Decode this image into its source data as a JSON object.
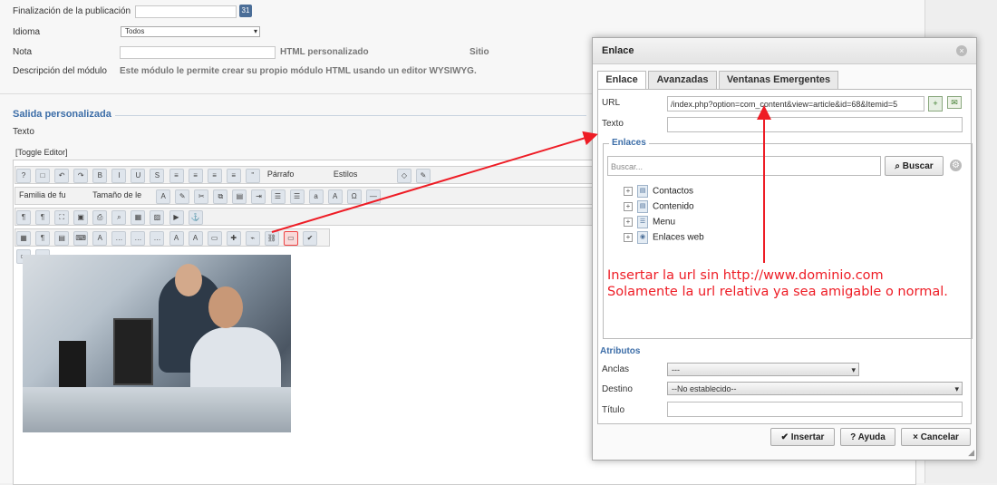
{
  "form": {
    "finalizacion_label": "Finalización de la publicación",
    "idioma_label": "Idioma",
    "idioma_value": "Todos",
    "nota_label": "Nota",
    "html_personalizado": "HTML personalizado",
    "sitio": "Sitio",
    "descripcion_label": "Descripción del módulo",
    "descripcion_value": "Este módulo le permite crear su propio módulo HTML usando un editor WYSIWYG.",
    "calendar_icon_text": "31"
  },
  "editor": {
    "section_title": "Salida personalizada",
    "texto_label": "Texto",
    "toggle_editor": "[Toggle Editor]",
    "paragraph_select": "Párrafo",
    "styles_select": "Estilos",
    "font_family": "Familia de fu",
    "font_size": "Tamaño de le"
  },
  "dialog": {
    "title": "Enlace",
    "close_icon": "×",
    "tabs": [
      {
        "label": "Enlace"
      },
      {
        "label": "Avanzadas"
      },
      {
        "label": "Ventanas Emergentes"
      }
    ],
    "url_label": "URL",
    "url_value": "/index.php?option=com_content&view=article&id=68&Itemid=5",
    "texto_label": "Texto",
    "texto_value": "",
    "enlaces_legend": "Enlaces",
    "search_placeholder": "Buscar...",
    "search_button": "Buscar",
    "tree": [
      {
        "label": "Contactos"
      },
      {
        "label": "Contenido"
      },
      {
        "label": "Menu"
      },
      {
        "label": "Enlaces web"
      }
    ],
    "atributos_legend": "Atributos",
    "anclas_label": "Anclas",
    "anclas_value": "---",
    "destino_label": "Destino",
    "destino_value": "--No establecido--",
    "titulo_label": "Título",
    "titulo_value": "",
    "insert_button": "Insertar",
    "help_button": "Ayuda",
    "cancel_button": "Cancelar"
  },
  "annotation": {
    "line1": "Insertar la url sin http://www.dominio.com",
    "line2": "Solamente la url relativa ya sea amigable o normal."
  },
  "colors": {
    "accent": "#3d6ea8",
    "annotation": "#ee1c25"
  }
}
